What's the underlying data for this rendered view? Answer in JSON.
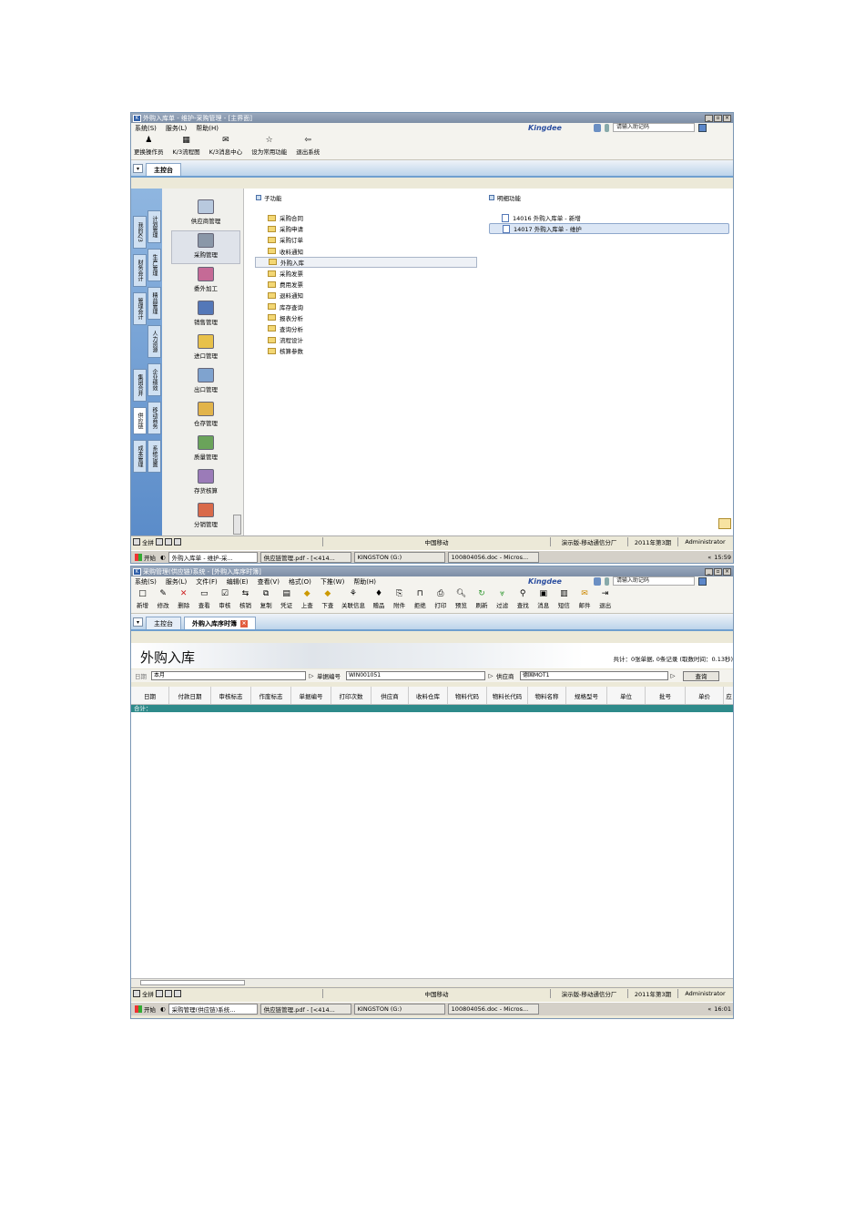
{
  "window1": {
    "title": "外购入库单 - 维护-采购管理 - [主界面]",
    "menu": [
      "系统(S)",
      "服务(L)",
      "帮助(H)"
    ],
    "brand": "Kingdee",
    "helper_placeholder": "请输入助记码",
    "toolbar": [
      {
        "label": "更换操作员",
        "icon": "user-switch-icon"
      },
      {
        "label": "K/3流程图",
        "icon": "flowchart-icon"
      },
      {
        "label": "K/3消息中心",
        "icon": "message-center-icon"
      },
      {
        "label": "设为常用功能",
        "icon": "favorite-icon"
      },
      {
        "label": "退出系统",
        "icon": "exit-icon"
      }
    ],
    "tab": "主控台",
    "left_tabs": [
      "我的K/3",
      "计划管理",
      "财务会计",
      "生产管理",
      "管理会计",
      "精益管理",
      "供应链",
      "人力资源",
      "成本管理",
      "企业绩效",
      "移动商务",
      "集团合并",
      "系统设置"
    ],
    "modules": [
      "供应商管理",
      "采购管理",
      "委外加工",
      "销售管理",
      "进口管理",
      "出口管理",
      "仓存管理",
      "质量管理",
      "存货核算",
      "分销管理"
    ],
    "sub_header": "子功能",
    "detail_header": "明细功能",
    "sub_functions": [
      "采购合同",
      "采购申请",
      "采购订单",
      "收料通知",
      "外购入库",
      "采购发票",
      "费用发票",
      "退料通知",
      "库存查询",
      "报表分析",
      "查询分析",
      "流程设计",
      "核算参数"
    ],
    "details": [
      "14016  外购入库单 - 新增",
      "14017  外购入库单 - 维护"
    ],
    "status": {
      "quick": "全拼",
      "carrier": "中国移动",
      "company": "演示版-移动通信分厂",
      "period": "2011年第3期",
      "user": "Administrator"
    },
    "taskbar": {
      "start": "开始",
      "tasks": [
        "外购入库单 - 维护-采...",
        "供应链管理.pdf - [<414...",
        "KINGSTON (G:)",
        "100804056.doc - Micros..."
      ],
      "time": "15:59"
    }
  },
  "window2": {
    "title": "采购管理(供应链)系统 - [外购入库序时簿]",
    "menu": [
      "系统(S)",
      "服务(L)",
      "文件(F)",
      "编辑(E)",
      "查看(V)",
      "格式(O)",
      "下推(W)",
      "帮助(H)"
    ],
    "brand": "Kingdee",
    "helper_placeholder": "请输入助记码",
    "toolbar": [
      "新增",
      "修改",
      "删除",
      "查看",
      "审核",
      "核销",
      "复制",
      "凭证",
      "上查",
      "下查",
      "关联信息",
      "赠品",
      "附件",
      "拒绝",
      "打印",
      "预览",
      "刷新",
      "过滤",
      "查找",
      "消息",
      "短信",
      "邮件",
      "退出"
    ],
    "tabs": [
      "主控台",
      "外购入库序时簿"
    ],
    "banner_title": "外购入库",
    "summary": "共计：0张单据, 0条记录 (取数时间：0.13秒)",
    "filter": {
      "date_label": "日期",
      "date_value": "本月",
      "bill_label": "单据编号",
      "bill_value": "WIN001051",
      "supplier_label": "供应商",
      "supplier_value": "德国MOT1",
      "query_button": "查询"
    },
    "columns": [
      "日期",
      "付款日期",
      "审核标志",
      "作废标志",
      "单据编号",
      "打印次数",
      "供应商",
      "收料仓库",
      "物料代码",
      "物料长代码",
      "物料名称",
      "规格型号",
      "单位",
      "批号",
      "单价",
      "应"
    ],
    "total_label": "合计：",
    "status": {
      "quick": "全拼",
      "carrier": "中国移动",
      "company": "演示版-移动通信分厂",
      "period": "2011年第3期",
      "user": "Administrator"
    },
    "taskbar": {
      "start": "开始",
      "tasks": [
        "采购管理(供应链)系统...",
        "供应链管理.pdf - [<414...",
        "KINGSTON (G:)",
        "100804056.doc - Micros..."
      ],
      "time": "16:01"
    }
  }
}
